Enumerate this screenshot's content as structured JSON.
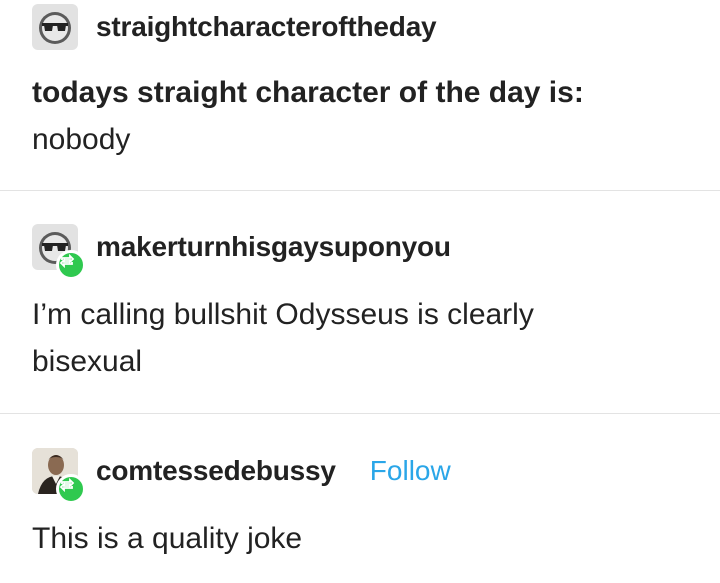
{
  "posts": [
    {
      "username": "straightcharacteroftheday",
      "title": "todays straight character of the day is:",
      "text": "nobody"
    },
    {
      "username": "makerturnhisgaysuponyou",
      "text_line1": "I’m calling bullshit Odysseus is clearly",
      "text_line2": "bisexual",
      "reblog_icon": "reblog-icon"
    },
    {
      "username": "comtessedebussy",
      "follow_label": "Follow",
      "text": "This is a quality joke",
      "reblog_icon": "reblog-icon"
    }
  ],
  "colors": {
    "follow": "#2aa6e8",
    "reblog_badge": "#2fc94f",
    "text": "#222222"
  }
}
